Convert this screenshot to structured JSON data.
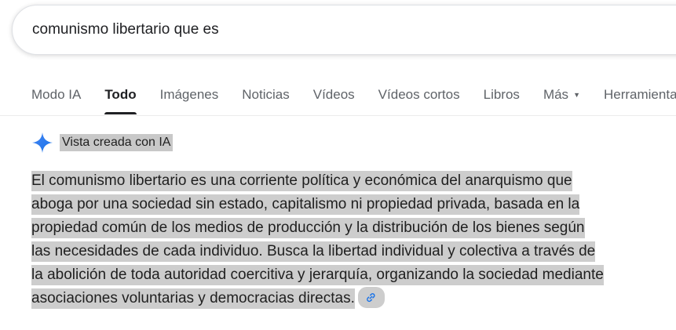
{
  "search": {
    "query": "comunismo libertario que es"
  },
  "tabs": [
    {
      "label": "Modo IA",
      "active": false
    },
    {
      "label": "Todo",
      "active": true
    },
    {
      "label": "Imágenes",
      "active": false
    },
    {
      "label": "Noticias",
      "active": false
    },
    {
      "label": "Vídeos",
      "active": false
    },
    {
      "label": "Vídeos cortos",
      "active": false
    },
    {
      "label": "Libros",
      "active": false
    },
    {
      "label": "Más",
      "active": false
    },
    {
      "label": "Herramientas",
      "active": false
    }
  ],
  "ai_overview": {
    "icon": "sparkle-icon",
    "title": "Vista creada con IA",
    "lines": [
      "El comunismo libertario es una corriente política y económica del anarquismo que",
      "aboga por una sociedad sin estado, capitalismo ni propiedad privada, basada en la",
      "propiedad común de los medios de producción y la distribución de los bienes según",
      "las necesidades de cada individuo. Busca la libertad individual y colectiva a través de",
      "la abolición de toda autoridad coercitiva y jerarquía, organizando la sociedad mediante",
      "asociaciones voluntarias y democracias directas."
    ],
    "link_icon": "link-icon"
  },
  "colors": {
    "accent_blue": "#4285f4",
    "active_tab": "#202124",
    "highlight": "#cdcdcd"
  }
}
